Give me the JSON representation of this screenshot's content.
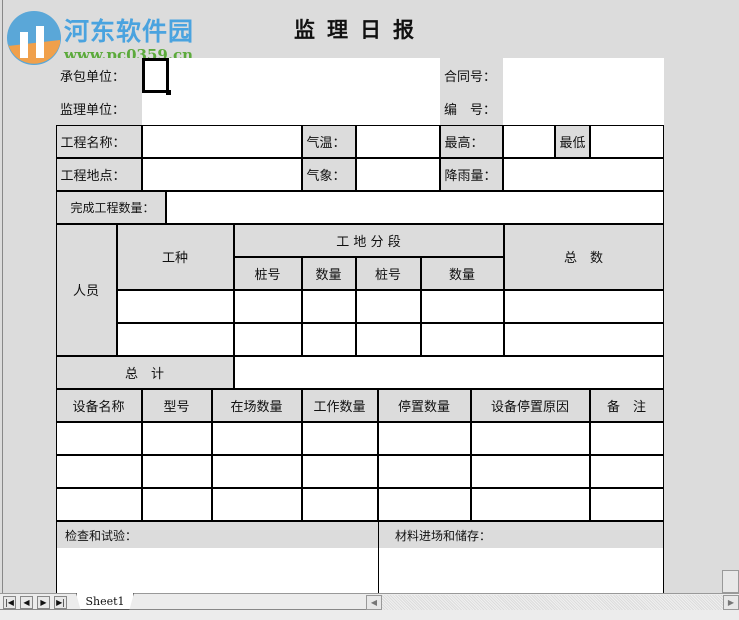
{
  "title": "监理日报",
  "watermark": {
    "name": "河东软件园",
    "url": "www.pc0359.cn"
  },
  "header": {
    "contractor_label": "承包单位：",
    "supervisor_label": "监理单位：",
    "contract_no_label": "合同号：",
    "number_label": "编　号："
  },
  "info": {
    "project_name": "工程名称：",
    "temperature": "气温：",
    "max": "最高：",
    "min": "最低",
    "project_location": "工程地点：",
    "weather": "气象：",
    "rainfall": "降雨量：",
    "completed_qty": "完成工程数量："
  },
  "personnel": {
    "label": "人员",
    "work_type": "工种",
    "segment": "工 地 分 段",
    "total": "总　数",
    "sub": [
      "桩号",
      "数量",
      "桩号",
      "数量"
    ],
    "grand_total": "总　计"
  },
  "equipment": {
    "headers": [
      "设备名称",
      "型号",
      "在场数量",
      "工作数量",
      "停置数量",
      "设备停置原因",
      "备　注"
    ]
  },
  "footer": {
    "inspection": "检查和试验：",
    "materials": "材料进场和储存："
  },
  "sheet_tab": "Sheet1"
}
